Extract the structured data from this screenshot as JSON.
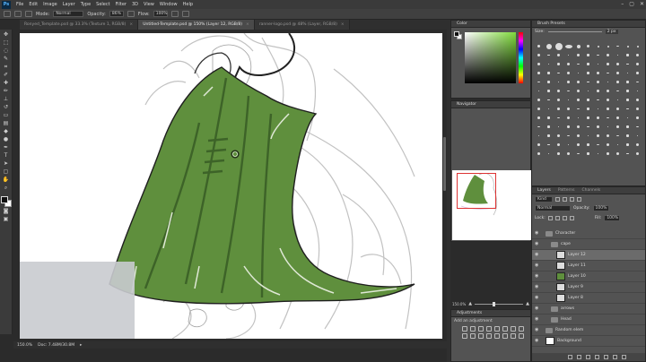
{
  "app": {
    "logo": "Ps",
    "menu": [
      "File",
      "Edit",
      "Image",
      "Layer",
      "Type",
      "Select",
      "Filter",
      "3D",
      "View",
      "Window",
      "Help"
    ],
    "window_controls": [
      "–",
      "▢",
      "✕"
    ]
  },
  "options": {
    "mode_label": "Mode:",
    "mode_value": "Normal",
    "opacity_label": "Opacity:",
    "opacity_value": "86%",
    "flow_label": "Flow:",
    "flow_value": "100%"
  },
  "documents": {
    "tabs": [
      {
        "label": "Ronyed_Template.psd @ 33.3% (Texture 1, RGB/8)",
        "active": false
      },
      {
        "label": "Untitled-Template.psd @ 150% (Layer 12, RGB/8)",
        "active": true
      },
      {
        "label": "ranner-logo.psd @ 48% (Layer, RGB/8)",
        "active": false
      }
    ]
  },
  "status": {
    "zoom": "150.0%",
    "doc_size": "Doc: 7.48M/30.8M"
  },
  "panels": {
    "color": {
      "tabs": [
        "Color"
      ],
      "hue_color": "#7fdc3b"
    },
    "brush_presets": {
      "tabs": [
        "Brush Presets"
      ],
      "size_label": "Size:",
      "size_value": "2 px"
    },
    "navigator": {
      "tabs": [
        "Navigator"
      ],
      "zoom": "150.0%"
    },
    "adjustments": {
      "tabs": [
        "Adjustments"
      ],
      "hint": "Add an adjustment"
    },
    "layers": {
      "tabs": [
        "Layers",
        "Patterns",
        "Channels"
      ],
      "kind_label": "Kind",
      "blend_mode": "Normal",
      "opacity_label": "Opacity:",
      "opacity_value": "100%",
      "lock_label": "Lock:",
      "fill_label": "Fill:",
      "fill_value": "100%",
      "rows": [
        {
          "type": "group",
          "name": "Character",
          "selected": false,
          "indent": 0
        },
        {
          "type": "group",
          "name": "cape",
          "selected": false,
          "indent": 1
        },
        {
          "type": "layer",
          "name": "Layer 12",
          "selected": true,
          "indent": 2,
          "thumb": "#dddddd"
        },
        {
          "type": "layer",
          "name": "Layer 11",
          "selected": false,
          "indent": 2,
          "thumb": "#dddddd"
        },
        {
          "type": "layer",
          "name": "Layer 10",
          "selected": false,
          "indent": 2,
          "thumb": "#5f8f3d"
        },
        {
          "type": "layer",
          "name": "Layer 9",
          "selected": false,
          "indent": 2,
          "thumb": "#dddddd"
        },
        {
          "type": "layer",
          "name": "Layer 8",
          "selected": false,
          "indent": 2,
          "thumb": "#dddddd"
        },
        {
          "type": "group",
          "name": "arrows",
          "selected": false,
          "indent": 1
        },
        {
          "type": "group",
          "name": "Head",
          "selected": false,
          "indent": 1
        },
        {
          "type": "group",
          "name": "Random elem",
          "selected": false,
          "indent": 0
        },
        {
          "type": "layer",
          "name": "Background",
          "selected": false,
          "indent": 0,
          "thumb": "#ffffff"
        }
      ]
    }
  },
  "colors": {
    "cape_fill": "#5f8f3d",
    "cape_dark": "#3d6328",
    "sketch_gray": "#bdbdbd"
  }
}
